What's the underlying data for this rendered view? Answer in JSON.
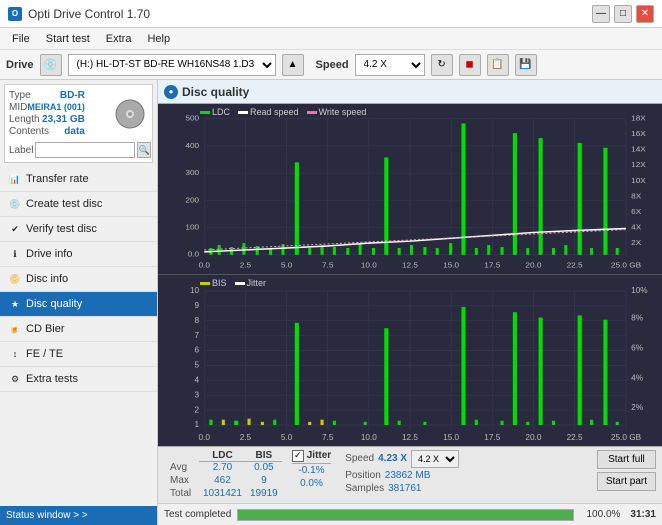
{
  "app": {
    "title": "Opti Drive Control 1.70",
    "icon": "O"
  },
  "titlebar": {
    "minimize": "—",
    "maximize": "□",
    "close": "✕"
  },
  "menu": {
    "items": [
      "File",
      "Start test",
      "Extra",
      "Help"
    ]
  },
  "drive_bar": {
    "label": "Drive",
    "drive_value": "(H:) HL-DT-ST BD-RE  WH16NS48 1.D3",
    "speed_label": "Speed",
    "speed_value": "4.2 X"
  },
  "disc": {
    "type_label": "Type",
    "type_val": "BD-R",
    "mid_label": "MID",
    "mid_val": "MEIRA1 (001)",
    "length_label": "Length",
    "length_val": "23,31 GB",
    "contents_label": "Contents",
    "contents_val": "data",
    "label_label": "Label"
  },
  "sidebar": {
    "nav_items": [
      {
        "id": "transfer-rate",
        "label": "Transfer rate",
        "icon": "📊"
      },
      {
        "id": "create-test-disc",
        "label": "Create test disc",
        "icon": "💿"
      },
      {
        "id": "verify-test-disc",
        "label": "Verify test disc",
        "icon": "✔"
      },
      {
        "id": "drive-info",
        "label": "Drive info",
        "icon": "ℹ"
      },
      {
        "id": "disc-info",
        "label": "Disc info",
        "icon": "📀"
      },
      {
        "id": "disc-quality",
        "label": "Disc quality",
        "icon": "★",
        "active": true
      },
      {
        "id": "cd-bier",
        "label": "CD Bier",
        "icon": "🍺"
      },
      {
        "id": "fe-te",
        "label": "FE / TE",
        "icon": "↕"
      },
      {
        "id": "extra-tests",
        "label": "Extra tests",
        "icon": "⚙"
      }
    ],
    "status_window": "Status window > >"
  },
  "disc_quality": {
    "title": "Disc quality",
    "chart1": {
      "legend": [
        {
          "label": "LDC",
          "color": "#00cc00"
        },
        {
          "label": "Read speed",
          "color": "#ffffff"
        },
        {
          "label": "Write speed",
          "color": "#ff69b4"
        }
      ],
      "y_labels_left": [
        "500",
        "400",
        "300",
        "200",
        "100",
        "0.0"
      ],
      "y_labels_right": [
        "18X",
        "16X",
        "14X",
        "12X",
        "10X",
        "8X",
        "6X",
        "4X",
        "2X"
      ],
      "x_labels": [
        "0.0",
        "2.5",
        "5.0",
        "7.5",
        "10.0",
        "12.5",
        "15.0",
        "17.5",
        "20.0",
        "22.5",
        "25.0 GB"
      ]
    },
    "chart2": {
      "legend": [
        {
          "label": "BIS",
          "color": "#cccc00"
        },
        {
          "label": "Jitter",
          "color": "#ffffff"
        }
      ],
      "y_labels_left": [
        "10",
        "9",
        "8",
        "7",
        "6",
        "5",
        "4",
        "3",
        "2",
        "1"
      ],
      "y_labels_right": [
        "10%",
        "8%",
        "6%",
        "4%",
        "2%"
      ],
      "x_labels": [
        "0.0",
        "2.5",
        "5.0",
        "7.5",
        "10.0",
        "12.5",
        "15.0",
        "17.5",
        "20.0",
        "22.5",
        "25.0 GB"
      ]
    }
  },
  "stats": {
    "col_headers": [
      "LDC",
      "BIS",
      "",
      "Jitter",
      "Speed"
    ],
    "avg_label": "Avg",
    "avg_ldc": "2.70",
    "avg_bis": "0.05",
    "avg_jitter": "-0.1%",
    "max_label": "Max",
    "max_ldc": "462",
    "max_bis": "9",
    "max_jitter": "0.0%",
    "total_label": "Total",
    "total_ldc": "1031421",
    "total_bis": "19919",
    "jitter_checked": true,
    "jitter_label": "Jitter",
    "speed_label": "Speed",
    "speed_val": "4.23 X",
    "position_label": "Position",
    "position_val": "23862 MB",
    "samples_label": "Samples",
    "samples_val": "381761",
    "speed_select": "4.2 X",
    "btn_start_full": "Start full",
    "btn_start_part": "Start part"
  },
  "progress": {
    "status_text": "Test completed",
    "percent": 100,
    "percent_display": "100.0%",
    "time": "31:31"
  },
  "colors": {
    "accent": "#1a6cb5",
    "active_nav": "#1a6cb5",
    "chart_bg": "#2a2a3e",
    "chart_grid": "#3a3a5a",
    "ldc_color": "#00dd00",
    "bis_color": "#cccc00",
    "read_speed_color": "#ffffff",
    "write_speed_color": "#ff69b4"
  }
}
